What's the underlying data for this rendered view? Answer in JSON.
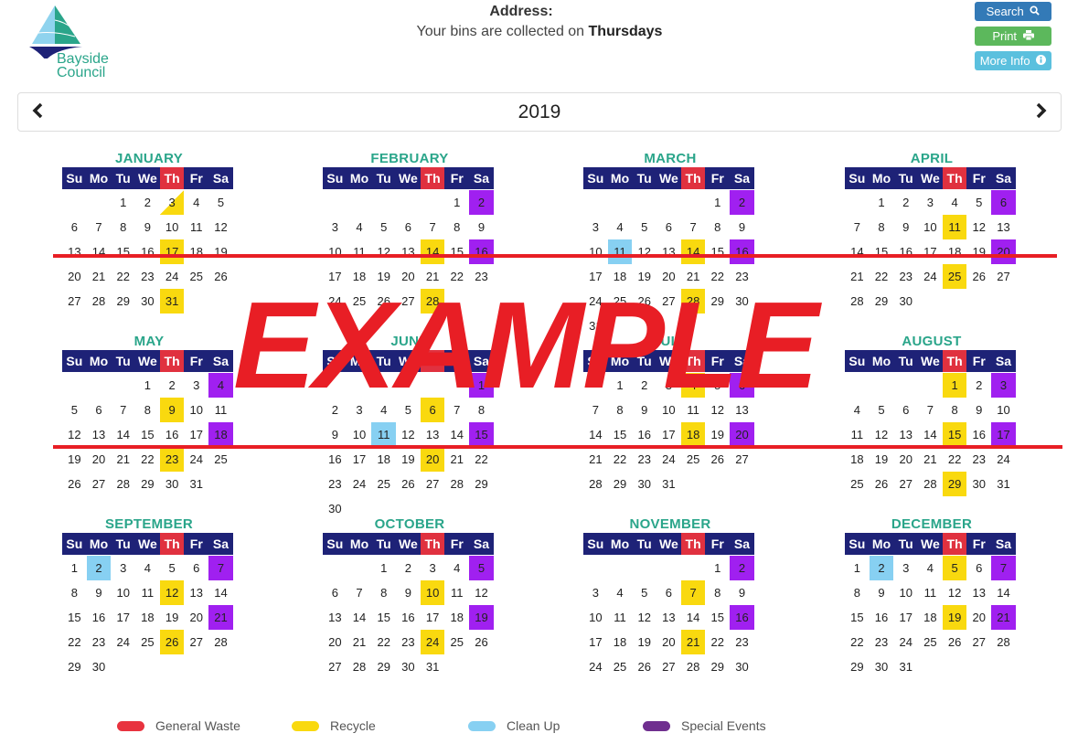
{
  "brand": {
    "name_line1": "Bayside",
    "name_line2": "Council",
    "colors": {
      "teal": "#2aa58a",
      "navy": "#1e2277",
      "lightblue": "#87d0f2"
    }
  },
  "header": {
    "address_label": "Address:",
    "collection_text": "Your bins are collected on ",
    "collection_day": "Thursdays"
  },
  "buttons": {
    "search": {
      "label": "Search",
      "icon": "search-icon"
    },
    "print": {
      "label": "Print",
      "icon": "printer-icon"
    },
    "info": {
      "label": "More Info",
      "icon": "info-icon"
    }
  },
  "year_nav": {
    "year": "2019",
    "prev_icon": "chevron-left-icon",
    "next_icon": "chevron-right-icon"
  },
  "weekdays": [
    "Su",
    "Mo",
    "Tu",
    "We",
    "Th",
    "Fr",
    "Sa"
  ],
  "collection_weekday_index": 4,
  "legend": [
    {
      "key": "general",
      "label": "General Waste",
      "color": "#e8333f"
    },
    {
      "key": "recycle",
      "label": "Recycle",
      "color": "#f9d90f"
    },
    {
      "key": "cleanup",
      "label": "Clean Up",
      "color": "#87d0f2"
    },
    {
      "key": "special",
      "label": "Special Events",
      "color": "#6f2f8f"
    }
  ],
  "watermark": "EXAMPLE",
  "months": [
    {
      "name": "JANUARY",
      "start": 2,
      "days": 31,
      "recycle": [
        17,
        31
      ],
      "recycle_half": [
        3
      ],
      "special": [],
      "cleanup": []
    },
    {
      "name": "FEBRUARY",
      "start": 5,
      "days": 28,
      "recycle": [
        14,
        28
      ],
      "special": [
        2,
        16
      ],
      "cleanup": []
    },
    {
      "name": "MARCH",
      "start": 5,
      "days": 31,
      "recycle": [
        14,
        28
      ],
      "special": [
        2,
        16
      ],
      "cleanup": [
        11
      ]
    },
    {
      "name": "APRIL",
      "start": 1,
      "days": 30,
      "recycle": [
        11,
        25
      ],
      "special": [
        6,
        20
      ],
      "cleanup": []
    },
    {
      "name": "MAY",
      "start": 3,
      "days": 31,
      "recycle": [
        9,
        23
      ],
      "special": [
        4,
        18
      ],
      "cleanup": []
    },
    {
      "name": "JUNE",
      "start": 6,
      "days": 30,
      "recycle": [
        6,
        20
      ],
      "special": [
        1,
        15
      ],
      "cleanup": [
        11
      ]
    },
    {
      "name": "JULY",
      "start": 1,
      "days": 31,
      "recycle": [
        4,
        18
      ],
      "special": [
        6,
        20
      ],
      "cleanup": []
    },
    {
      "name": "AUGUST",
      "start": 4,
      "days": 31,
      "recycle": [
        1,
        15,
        29
      ],
      "special": [
        3,
        17
      ],
      "cleanup": []
    },
    {
      "name": "SEPTEMBER",
      "start": 0,
      "days": 30,
      "recycle": [
        12,
        26
      ],
      "special": [
        7,
        21
      ],
      "cleanup": [
        2
      ]
    },
    {
      "name": "OCTOBER",
      "start": 2,
      "days": 31,
      "recycle": [
        10,
        24
      ],
      "special": [
        5,
        19
      ],
      "cleanup": []
    },
    {
      "name": "NOVEMBER",
      "start": 5,
      "days": 30,
      "recycle": [
        7,
        21
      ],
      "special": [
        2,
        16
      ],
      "cleanup": []
    },
    {
      "name": "DECEMBER",
      "start": 0,
      "days": 31,
      "recycle": [
        5,
        19
      ],
      "special": [
        7,
        21
      ],
      "cleanup": [
        2
      ]
    }
  ]
}
